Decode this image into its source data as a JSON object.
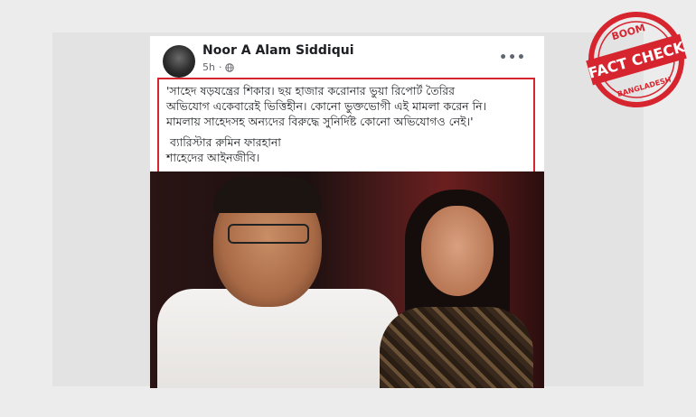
{
  "post": {
    "author": "Noor A Alam Siddiqui",
    "time": "5h",
    "menu_label": "•••",
    "quote": "'সাহেদ ষড়যন্ত্রের শিকার। ছয় হাজার করোনার ভুয়া রিপোর্ট তৈরির\nঅভিযোগ একেবারেই ভিত্তিহীন। কোনো ভুক্তভোগী এই মামলা করেন নি।\nমামলায় সাহেদসহ অন্যদের বিরুদ্ধে সুনির্দিষ্ট কোনো অভিযোগও নেই।'",
    "signature": " ব্যারিস্টার রুমিন ফারহানা\nশাহেদের আইনজীবি।"
  },
  "stamp": {
    "top": "BOOM",
    "main": "FACT CHECK",
    "bottom": "BANGLADESH",
    "color": "#d6252f"
  }
}
